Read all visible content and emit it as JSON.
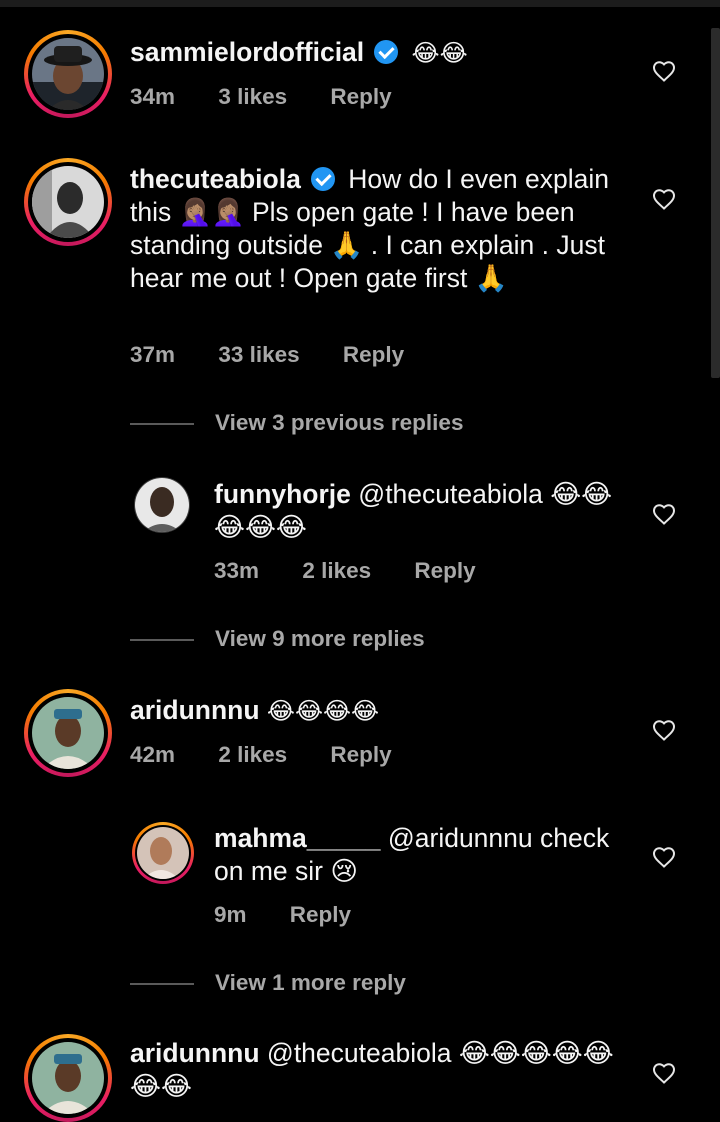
{
  "comments": [
    {
      "username": "sammielordofficial",
      "verified": true,
      "text": "😂😂",
      "time": "34m",
      "likes": "3 likes",
      "reply_label": "Reply"
    },
    {
      "username": "thecuteabiola",
      "verified": true,
      "text": "How do I even explain this 🤦🏽‍♀️🤦🏽‍♀️ Pls open gate ! I have been standing outside 🙏 . I can explain . Just hear me out ! Open gate first 🙏",
      "time": "37m",
      "likes": "33 likes",
      "reply_label": "Reply",
      "view_previous": "View 3 previous replies"
    },
    {
      "username": "funnyhorje",
      "verified": false,
      "text": "@thecuteabiola 😂😂😂😂😂",
      "time": "33m",
      "likes": "2 likes",
      "reply_label": "Reply",
      "view_more": "View 9 more replies"
    },
    {
      "username": "aridunnnu",
      "verified": false,
      "text": "😂😂😂😂",
      "time": "42m",
      "likes": "2 likes",
      "reply_label": "Reply"
    },
    {
      "username": "mahma_____",
      "verified": false,
      "text": "@aridunnnu check on me sir 😢",
      "time": "9m",
      "reply_label": "Reply",
      "view_more": "View 1 more reply"
    },
    {
      "username": "aridunnnu",
      "verified": false,
      "text": "@thecuteabiola 😂😂😂😂😂😂😂"
    }
  ],
  "icons": {
    "like": "heart-outline-icon",
    "verified": "verified-badge-icon"
  },
  "colors": {
    "background": "#000000",
    "text": "#f5f5f5",
    "meta": "#a8a8a8",
    "verified": "#2196f3"
  }
}
